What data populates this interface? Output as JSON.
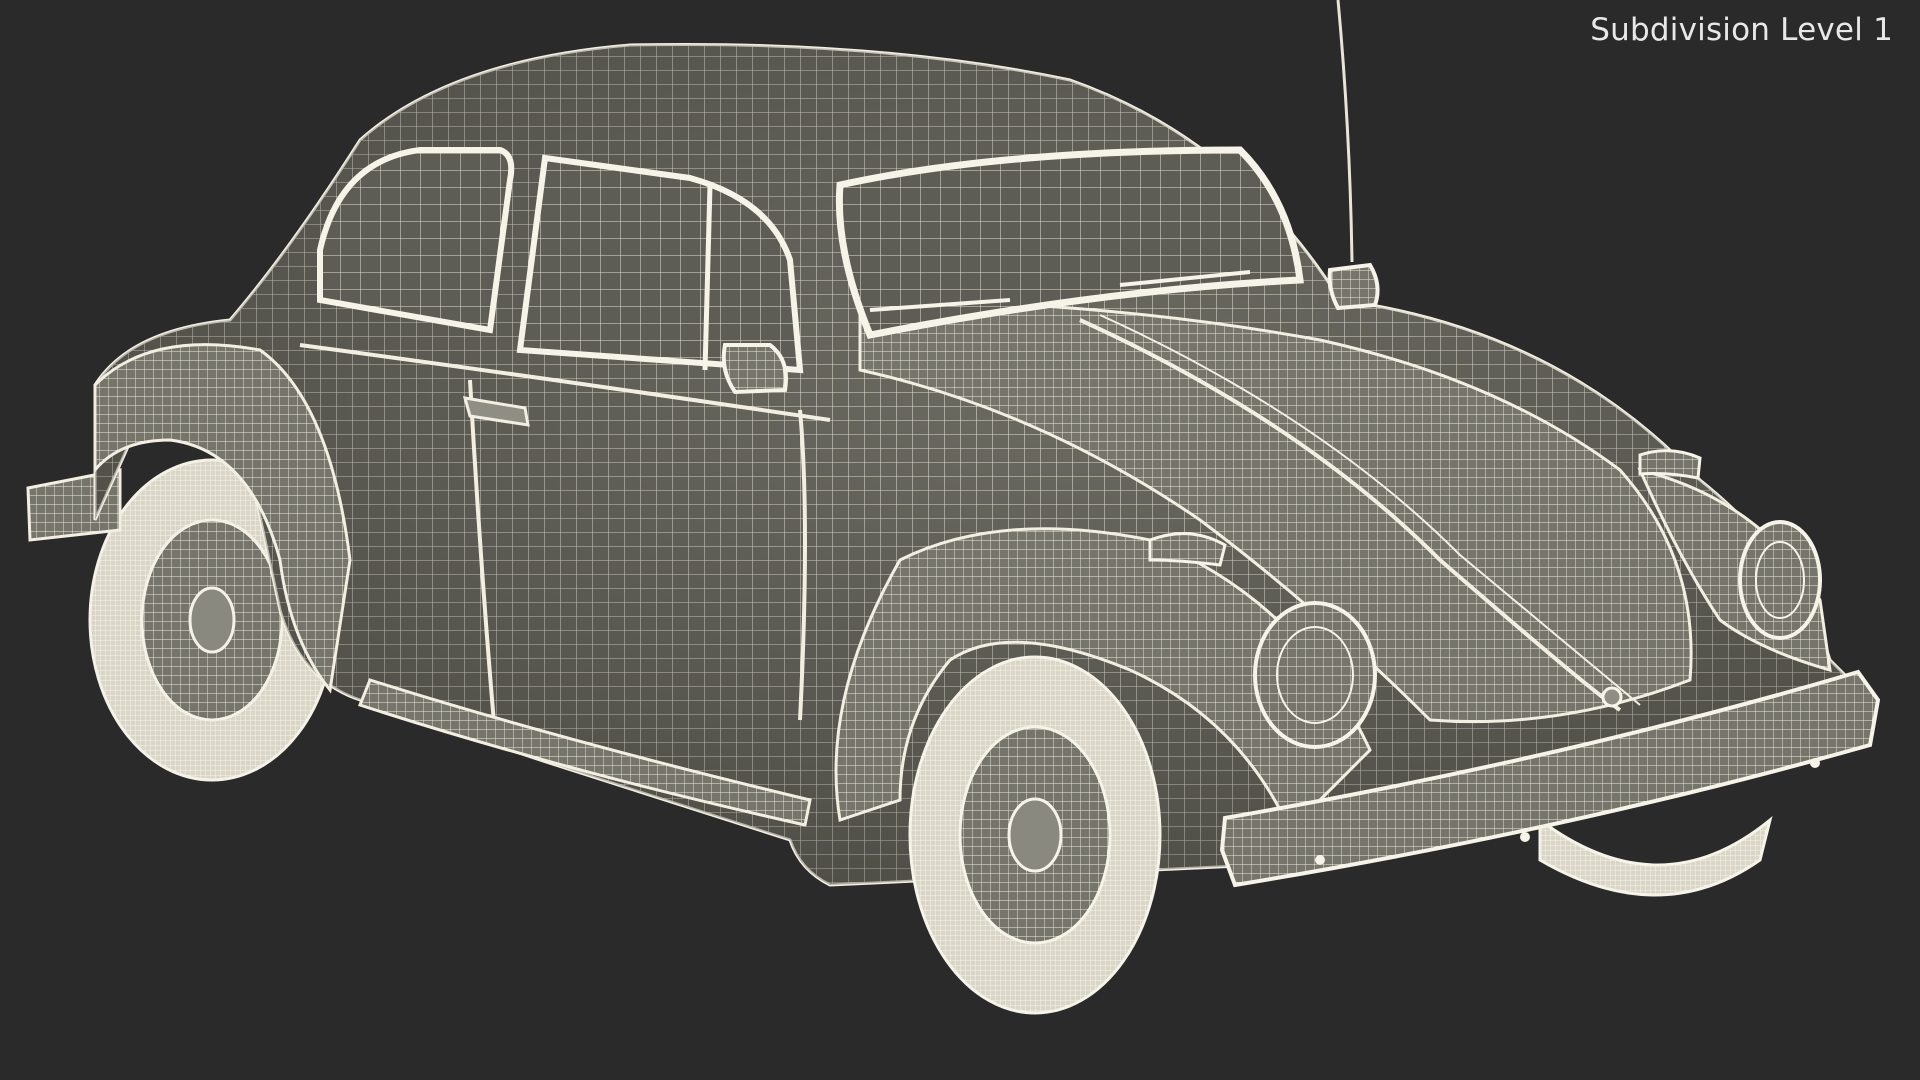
{
  "viewport": {
    "overlay_label": "Subdivision Level 1",
    "background_color": "#2a2a2a",
    "wire_color": "#f2efe2",
    "body_color": "#6e6d63",
    "glass_color": "#5f5e56"
  },
  "render": {
    "subject": "car-wireframe-render"
  }
}
